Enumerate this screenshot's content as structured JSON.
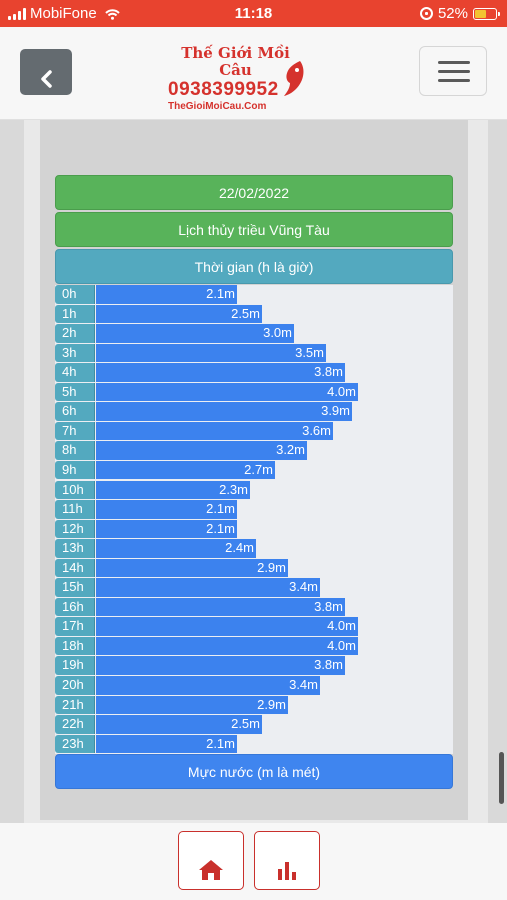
{
  "status_bar": {
    "carrier": "MobiFone",
    "time": "11:18",
    "battery": "52%"
  },
  "header": {
    "logo_title": "Thế Giới Mồi Câu",
    "logo_phone": "0938399952",
    "logo_site": "TheGioiMoiCau.Com"
  },
  "tide": {
    "date": "22/02/2022",
    "title": "Lịch thủy triều Vũng Tàu",
    "time_header": "Thời gian (h là giờ)",
    "level_footer": "Mực nước (m là mét)",
    "unit": "m",
    "max_level": 4.0,
    "rows": [
      {
        "hour": "0h",
        "level": "2.1m",
        "value": 2.1
      },
      {
        "hour": "1h",
        "level": "2.5m",
        "value": 2.5
      },
      {
        "hour": "2h",
        "level": "3.0m",
        "value": 3.0
      },
      {
        "hour": "3h",
        "level": "3.5m",
        "value": 3.5
      },
      {
        "hour": "4h",
        "level": "3.8m",
        "value": 3.8
      },
      {
        "hour": "5h",
        "level": "4.0m",
        "value": 4.0
      },
      {
        "hour": "6h",
        "level": "3.9m",
        "value": 3.9
      },
      {
        "hour": "7h",
        "level": "3.6m",
        "value": 3.6
      },
      {
        "hour": "8h",
        "level": "3.2m",
        "value": 3.2
      },
      {
        "hour": "9h",
        "level": "2.7m",
        "value": 2.7
      },
      {
        "hour": "10h",
        "level": "2.3m",
        "value": 2.3
      },
      {
        "hour": "11h",
        "level": "2.1m",
        "value": 2.1
      },
      {
        "hour": "12h",
        "level": "2.1m",
        "value": 2.1
      },
      {
        "hour": "13h",
        "level": "2.4m",
        "value": 2.4
      },
      {
        "hour": "14h",
        "level": "2.9m",
        "value": 2.9
      },
      {
        "hour": "15h",
        "level": "3.4m",
        "value": 3.4
      },
      {
        "hour": "16h",
        "level": "3.8m",
        "value": 3.8
      },
      {
        "hour": "17h",
        "level": "4.0m",
        "value": 4.0
      },
      {
        "hour": "18h",
        "level": "4.0m",
        "value": 4.0
      },
      {
        "hour": "19h",
        "level": "3.8m",
        "value": 3.8
      },
      {
        "hour": "20h",
        "level": "3.4m",
        "value": 3.4
      },
      {
        "hour": "21h",
        "level": "2.9m",
        "value": 2.9
      },
      {
        "hour": "22h",
        "level": "2.5m",
        "value": 2.5
      },
      {
        "hour": "23h",
        "level": "2.1m",
        "value": 2.1
      }
    ]
  },
  "footer": {
    "buttons": [
      {
        "icon": "home-icon"
      },
      {
        "icon": "bar-chart-icon"
      }
    ]
  },
  "colors": {
    "status_bar": "#e8432f",
    "green": "#58b35a",
    "teal": "#53a9bf",
    "blue": "#3c82ee",
    "brand_red": "#d5322d"
  }
}
